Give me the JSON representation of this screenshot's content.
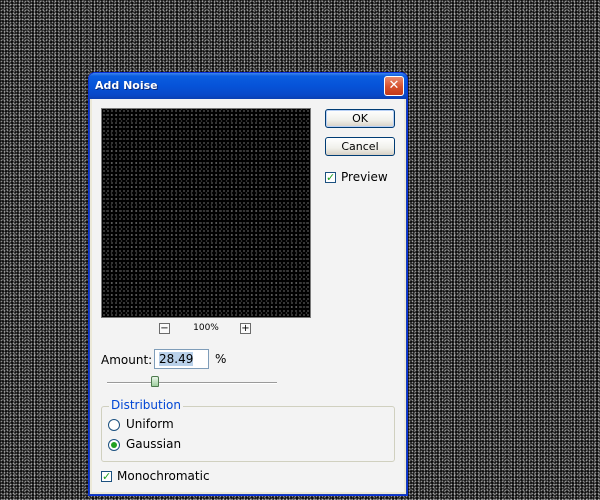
{
  "dialog": {
    "title": "Add Noise",
    "close_glyph": "✕",
    "buttons": {
      "ok_label": "OK",
      "cancel_label": "Cancel"
    },
    "preview": {
      "checkbox_label": "Preview",
      "checked": true
    },
    "zoom": {
      "out_glyph": "−",
      "in_glyph": "+",
      "level": "100%"
    },
    "amount": {
      "label": "Amount:",
      "value": "28.49",
      "unit": "%",
      "slider_fraction": 0.2849
    },
    "distribution": {
      "legend": "Distribution",
      "options": [
        {
          "label": "Uniform",
          "selected": false
        },
        {
          "label": "Gaussian",
          "selected": true
        }
      ]
    },
    "monochromatic": {
      "label": "Monochromatic",
      "checked": true
    },
    "check_glyph": "✓"
  },
  "colors": {
    "titlebar": "#0653d8",
    "accent_green": "#21a121",
    "group_legend": "#0046d5"
  }
}
